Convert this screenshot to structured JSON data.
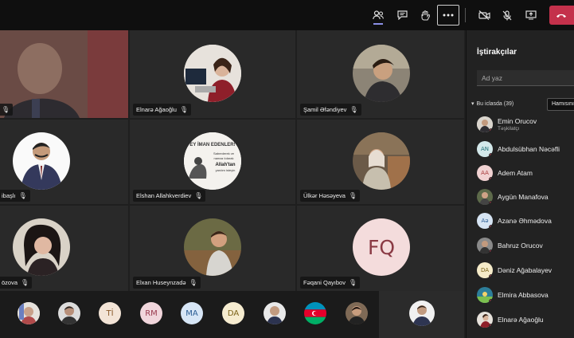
{
  "toolbar": {
    "buttons": [
      "participants-icon",
      "chat-icon",
      "raise-hand-icon",
      "more-icon",
      "camera-off-icon",
      "mic-off-icon",
      "share-icon",
      "hangup-icon"
    ]
  },
  "tiles": [
    {
      "name": "",
      "type": "video"
    },
    {
      "name": "Elnarə Ağaoğlu",
      "type": "photo"
    },
    {
      "name": "Şamil Əfəndiyev",
      "type": "photo"
    },
    {
      "name": "ibaşlı",
      "type": "photo"
    },
    {
      "name": "Elshan Allahkverdiev",
      "type": "photo",
      "poster_lines": [
        "EY İMAN EDENLER!",
        "Sabrederek ve",
        "namaz kılarak",
        "Allah'tan",
        "yardım isteyin"
      ]
    },
    {
      "name": "Ülkər Həsəyeva",
      "type": "photo"
    },
    {
      "name": "özova",
      "type": "photo"
    },
    {
      "name": "Elxan Huseynzadə",
      "type": "photo"
    },
    {
      "name": "Fəqani Qayıbov",
      "type": "initials",
      "initials": "FQ"
    }
  ],
  "strip": [
    {
      "kind": "photo"
    },
    {
      "kind": "photo"
    },
    {
      "kind": "initials",
      "text": "Tİ",
      "bg": "#f3e4d6",
      "fg": "#8a5a2a"
    },
    {
      "kind": "initials",
      "text": "RM",
      "bg": "#f1d6dc",
      "fg": "#9a3a4e"
    },
    {
      "kind": "initials",
      "text": "MA",
      "bg": "#d7e6f6",
      "fg": "#2b5d94"
    },
    {
      "kind": "initials",
      "text": "DA",
      "bg": "#f6ecd0",
      "fg": "#7b6218"
    },
    {
      "kind": "photo"
    },
    {
      "kind": "photo"
    },
    {
      "kind": "photo"
    },
    {
      "kind": "photo"
    }
  ],
  "panel": {
    "title": "İştirakçılar",
    "search_placeholder": "Ad yaz",
    "group_label": "Bu iclasda (39)",
    "mute_all": "Hamısını",
    "participants": [
      {
        "name": "Emin Orucov",
        "role": "Təşkilatçı",
        "kind": "photo"
      },
      {
        "name": "Abdulsübhan Nəcəfli",
        "initials": "AN",
        "bg": "#d3e8ea",
        "fg": "#1f6e75"
      },
      {
        "name": "Adem Atam",
        "initials": "AA",
        "bg": "#f1d2d2",
        "fg": "#a83a3a"
      },
      {
        "name": "Aygün Manafova",
        "kind": "photo"
      },
      {
        "name": "Azanə Əhmədova",
        "initials": "Aə",
        "bg": "#d6e4f3",
        "fg": "#2b5d94"
      },
      {
        "name": "Bahruz Orucov",
        "kind": "photo"
      },
      {
        "name": "Dəniz Ağabalayev",
        "initials": "DA",
        "bg": "#f5ebc9",
        "fg": "#7b6218"
      },
      {
        "name": "Elmira Abbasova",
        "kind": "photo"
      },
      {
        "name": "Elnarə Ağaoğlu",
        "kind": "photo"
      }
    ]
  }
}
